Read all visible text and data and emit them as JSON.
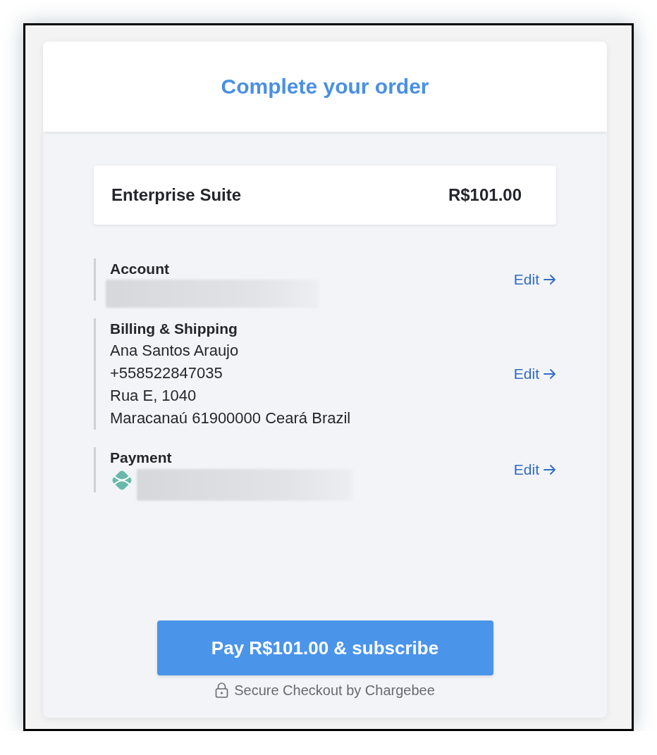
{
  "header": {
    "title": "Complete your order"
  },
  "product": {
    "name": "Enterprise Suite",
    "price": "R$101.00"
  },
  "sections": [
    {
      "kind": "account",
      "title": "Account",
      "redacted": true,
      "action": "Edit"
    },
    {
      "kind": "address",
      "title": "Billing & Shipping",
      "lines": [
        "Ana Santos Araujo",
        "+558522847035",
        "Rua E, 1040",
        "Maracanaú 61900000 Ceará Brazil"
      ],
      "action": "Edit"
    },
    {
      "kind": "payment",
      "title": "Payment",
      "redacted": true,
      "action": "Edit"
    }
  ],
  "pay_button": {
    "label": "Pay R$101.00 & subscribe"
  },
  "secure_note": "Secure Checkout by Chargebee"
}
